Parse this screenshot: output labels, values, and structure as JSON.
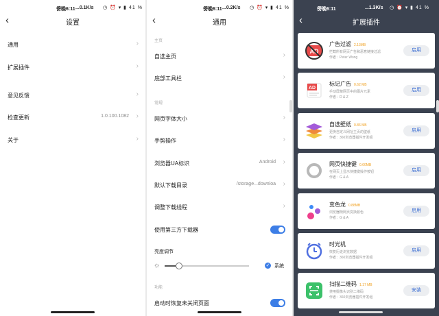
{
  "status": {
    "time": "傍晚6:11",
    "net1": "...0.1K/s",
    "net2": "...0.2K/s",
    "net3": "...1.3K/s",
    "icons": "◷ ⏰ ▾ ▮ 41 %",
    "battery": "41"
  },
  "settings": {
    "title": "设置",
    "items": [
      {
        "label": "通用"
      },
      {
        "label": "扩展插件"
      },
      {
        "label": "意见反馈"
      },
      {
        "label": "检查更新",
        "value": "1.0.100.1082"
      },
      {
        "label": "关于"
      }
    ]
  },
  "general": {
    "title": "通用",
    "section_home": "主页",
    "section_general": "常规",
    "section_func": "功能",
    "items": [
      {
        "label": "自选主页"
      },
      {
        "label": "底部工具栏"
      },
      {
        "label": "网页字体大小"
      },
      {
        "label": "手势操作"
      },
      {
        "label": "浏览器UA标识",
        "value": "Android"
      },
      {
        "label": "默认下载目录",
        "value": "/storage...downloa"
      },
      {
        "label": "调整下载线程"
      },
      {
        "label": "使用第三方下载器",
        "toggle": true
      },
      {
        "label": "启动时恢复未关闭页面",
        "toggle": true
      }
    ],
    "brightness_label": "亮度调节",
    "brightness_level": 0.17,
    "system_label": "系统"
  },
  "plugins": {
    "title": "扩展插件",
    "items": [
      {
        "name": "广告过滤",
        "size": "2.13MB",
        "desc": "拦截所有网页广告和恶意链接过滤",
        "author": "作者：Peter Wong",
        "button": "启用"
      },
      {
        "name": "标记广告",
        "size": "0.62 MB",
        "desc": "手动屏蔽网页中的图片元素",
        "author": "作者：D & Z",
        "button": "启用"
      },
      {
        "name": "自选壁纸",
        "size": "0.86 MB",
        "desc": "更换自定义网址主页的壁纸",
        "author": "作者：360浏览器插件开发组",
        "button": "启用"
      },
      {
        "name": "网页快捷键",
        "size": "0.60MB",
        "desc": "在网页上显示快捷键操作按钮",
        "author": "作者：G & A",
        "button": "启用"
      },
      {
        "name": "变色龙",
        "size": "0.88MB",
        "desc": "浏览器随网页变换颜色",
        "author": "作者：G & A",
        "button": "启用"
      },
      {
        "name": "时光机",
        "size": "",
        "desc": "恢复历史浏览数据",
        "author": "作者：360浏览器插件开发组",
        "button": "启用"
      },
      {
        "name": "扫描二维码",
        "size": "1.17 MB",
        "desc": "使用摄像头识别二维码",
        "author": "作者：360浏览器插件开发组",
        "button": "安装"
      }
    ]
  }
}
